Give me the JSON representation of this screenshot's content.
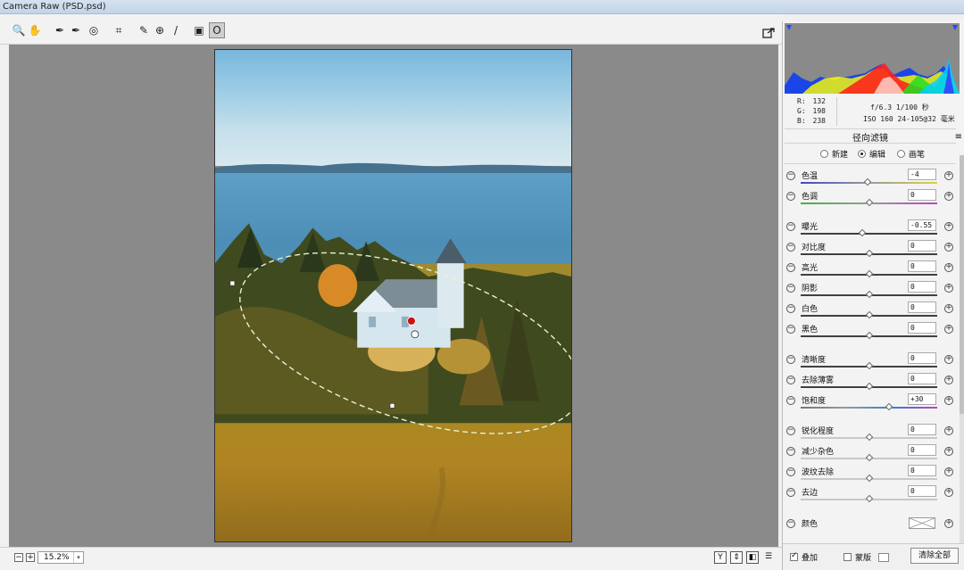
{
  "window": {
    "title": "Camera Raw (PSD.psd)"
  },
  "toolbar": {
    "tools": [
      {
        "name": "zoom-tool",
        "glyph": "🔍"
      },
      {
        "name": "hand-tool",
        "glyph": "✋"
      },
      {
        "name": "white-balance-tool",
        "glyph": "✒"
      },
      {
        "name": "color-sampler-tool",
        "glyph": "✒"
      },
      {
        "name": "targeted-adjustment-tool",
        "glyph": "◎"
      },
      {
        "name": "crop-tool",
        "glyph": "⌗"
      },
      {
        "name": "spot-removal-tool",
        "glyph": "✎"
      },
      {
        "name": "red-eye-tool",
        "glyph": "⊕"
      },
      {
        "name": "adjustment-brush-tool",
        "glyph": "/"
      },
      {
        "name": "graduated-filter-tool",
        "glyph": "▣"
      },
      {
        "name": "radial-filter-tool",
        "glyph": "O"
      }
    ],
    "export_icon": "open-in-new-icon"
  },
  "bottom": {
    "zoom_minus": "−",
    "zoom_plus": "+",
    "zoom_value": "15.2%",
    "view_buttons": [
      "Y",
      "⇕",
      "◧",
      "☰"
    ]
  },
  "info": {
    "r_label": "R:",
    "r_value": "132",
    "g_label": "G:",
    "g_value": "198",
    "b_label": "B:",
    "b_value": "238",
    "aperture_shutter": "f/6.3  1/100 秒",
    "iso_lens": "ISO 160  24-105@32 毫米"
  },
  "panel": {
    "title": "径向滤镜",
    "modes": [
      {
        "label": "新建",
        "selected": false
      },
      {
        "label": "编辑",
        "selected": true
      },
      {
        "label": "画笔",
        "selected": false
      }
    ],
    "sliders": [
      {
        "label": "色温",
        "value": "-4",
        "pos": 0.49,
        "track": "temp"
      },
      {
        "label": "色调",
        "value": "0",
        "pos": 0.5,
        "track": "tint"
      },
      {
        "label": "曝光",
        "value": "-0.55",
        "pos": 0.45,
        "track": "dark"
      },
      {
        "label": "对比度",
        "value": "0",
        "pos": 0.5,
        "track": "dark"
      },
      {
        "label": "高光",
        "value": "0",
        "pos": 0.5,
        "track": "dark"
      },
      {
        "label": "阴影",
        "value": "0",
        "pos": 0.5,
        "track": "dark"
      },
      {
        "label": "白色",
        "value": "0",
        "pos": 0.5,
        "track": "dark"
      },
      {
        "label": "黑色",
        "value": "0",
        "pos": 0.5,
        "track": "dark"
      },
      {
        "label": "清晰度",
        "value": "0",
        "pos": 0.5,
        "track": "dark"
      },
      {
        "label": "去除薄雾",
        "value": "0",
        "pos": 0.5,
        "track": "dark"
      },
      {
        "label": "饱和度",
        "value": "+30",
        "pos": 0.65,
        "track": "sat"
      },
      {
        "label": "锐化程度",
        "value": "0",
        "pos": 0.5,
        "track": "light"
      },
      {
        "label": "减少杂色",
        "value": "0",
        "pos": 0.5,
        "track": "light"
      },
      {
        "label": "波纹去除",
        "value": "0",
        "pos": 0.5,
        "track": "light"
      },
      {
        "label": "去边",
        "value": "0",
        "pos": 0.5,
        "track": "light"
      }
    ],
    "color_label": "颜色",
    "footer": {
      "overlay_label": "叠加",
      "overlay_checked": true,
      "mask_label": "蒙版",
      "mask_checked": false,
      "clear_all": "清除全部"
    }
  },
  "colors": {
    "accent": "#0044cc",
    "canvas": "#8a8a8a",
    "mask_pin": "#cc1111"
  }
}
